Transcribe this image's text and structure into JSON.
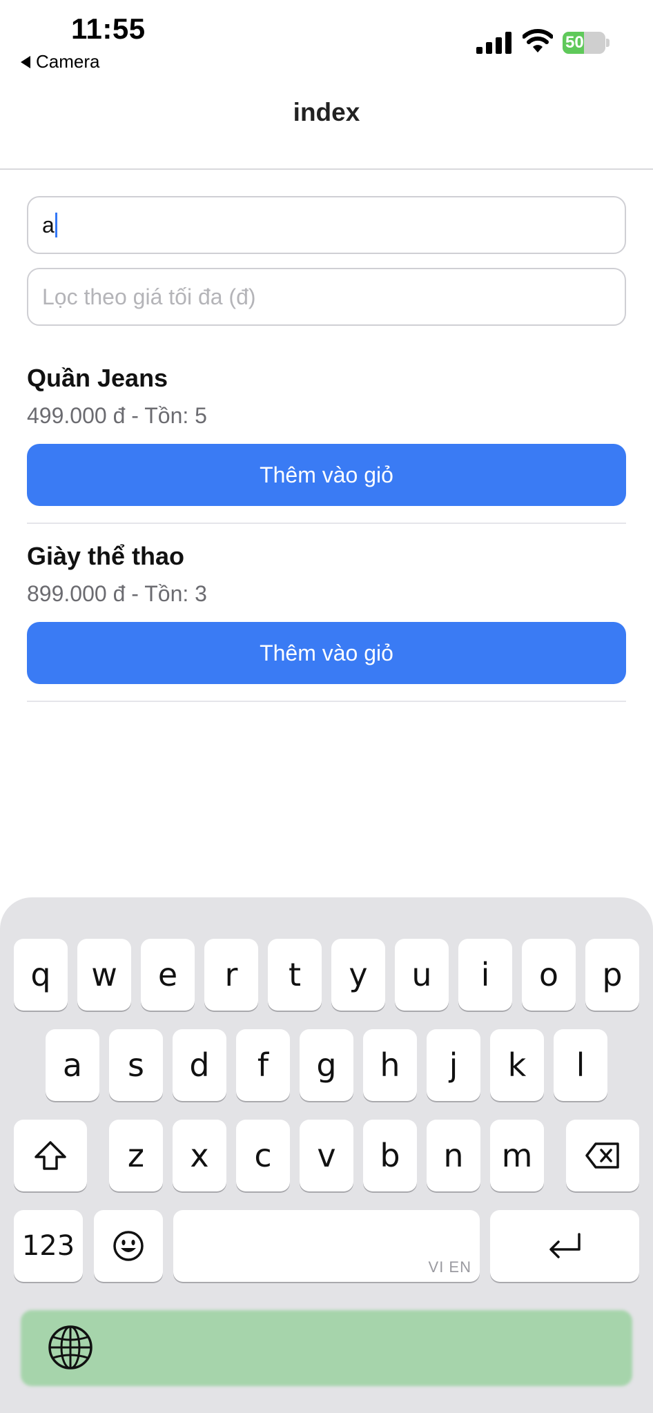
{
  "status_bar": {
    "time": "11:55",
    "back_app": "Camera",
    "battery_percent": "50",
    "battery_level": 0.5,
    "battery_color": "#5fc95a"
  },
  "nav": {
    "title": "index"
  },
  "search": {
    "value": "a"
  },
  "price_filter": {
    "value": "",
    "placeholder": "Lọc theo giá tối đa (đ)"
  },
  "products": [
    {
      "name": "Quần Jeans",
      "meta": "499.000 đ - Tồn: 5",
      "button_label": "Thêm vào giỏ"
    },
    {
      "name": "Giày thể thao",
      "meta": "899.000 đ - Tồn: 3",
      "button_label": "Thêm vào giỏ"
    }
  ],
  "colors": {
    "accent": "#3a7bf4",
    "caret": "#3478f6"
  },
  "keyboard": {
    "row1": [
      "q",
      "w",
      "e",
      "r",
      "t",
      "y",
      "u",
      "i",
      "o",
      "p"
    ],
    "row2": [
      "a",
      "s",
      "d",
      "f",
      "g",
      "h",
      "j",
      "k",
      "l"
    ],
    "row3": [
      "z",
      "x",
      "c",
      "v",
      "b",
      "n",
      "m"
    ],
    "numbers_key": "123",
    "space_lang": "VI EN",
    "icons": [
      "shift-icon",
      "backspace-icon",
      "emoji-icon",
      "return-icon",
      "globe-icon"
    ]
  }
}
